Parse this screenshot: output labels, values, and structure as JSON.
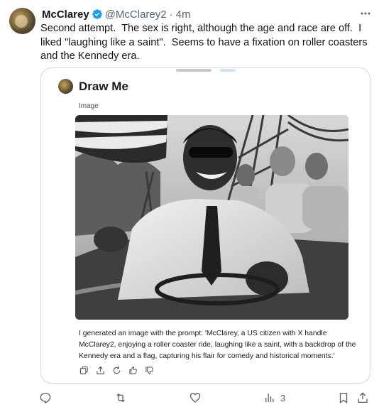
{
  "tweet": {
    "display_name": "McClarey",
    "handle": "@McClarey2",
    "separator": "·",
    "time": "4m",
    "text": "Second attempt.  The sex is right, although the age and race are off.  I liked \"laughing like a saint\".  Seems to have a fixation on roller coasters and the Kennedy era."
  },
  "card": {
    "title": "Draw Me",
    "subtitle": "Image",
    "caption": "I generated an image with the prompt: 'McClarey, a US citizen with X handle McClarey2, enjoying a roller coaster ride, laughing like a saint, with a backdrop of the Kennedy era and a flag, capturing his flair for comedy and historical moments.'"
  },
  "actions": {
    "views_count": "3"
  },
  "colors": {
    "verified": "#1d9bf0",
    "muted": "#536471",
    "border": "#cfd9de"
  },
  "icons": [
    "verified-badge-icon",
    "more-icon",
    "copy-icon",
    "share-icon",
    "regenerate-icon",
    "thumbs-up-icon",
    "thumbs-down-icon",
    "reply-icon",
    "retweet-icon",
    "like-icon",
    "views-icon",
    "bookmark-icon",
    "share-icon"
  ]
}
